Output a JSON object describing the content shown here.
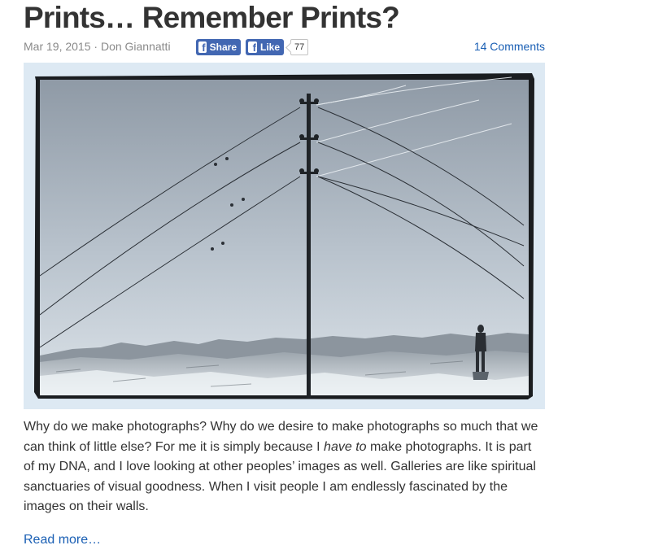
{
  "post": {
    "title": "Prints… Remember Prints?",
    "date": "Mar 19, 2015",
    "separator": "·",
    "author": "Don Giannatti",
    "share_label": "Share",
    "like_label": "Like",
    "like_count": "77",
    "comments_label": "14 Comments",
    "body_1": "Why do we make photographs? Why do we desire to make photographs so much that we can think of little else? For me it is simply because I ",
    "body_em": "have to",
    "body_2": " make photographs. It is part of my DNA, and I love looking at other peoples’ images as well. Galleries are like spiritual sanctuaries of visual goodness. When I visit people I am endlessly fascinated by the images on their walls.",
    "read_more": "Read more…"
  },
  "colors": {
    "link": "#1a5fb4",
    "facebook": "#4267b2",
    "photo_mat": "#dde9f3"
  },
  "icons": {
    "facebook": "facebook-icon"
  }
}
